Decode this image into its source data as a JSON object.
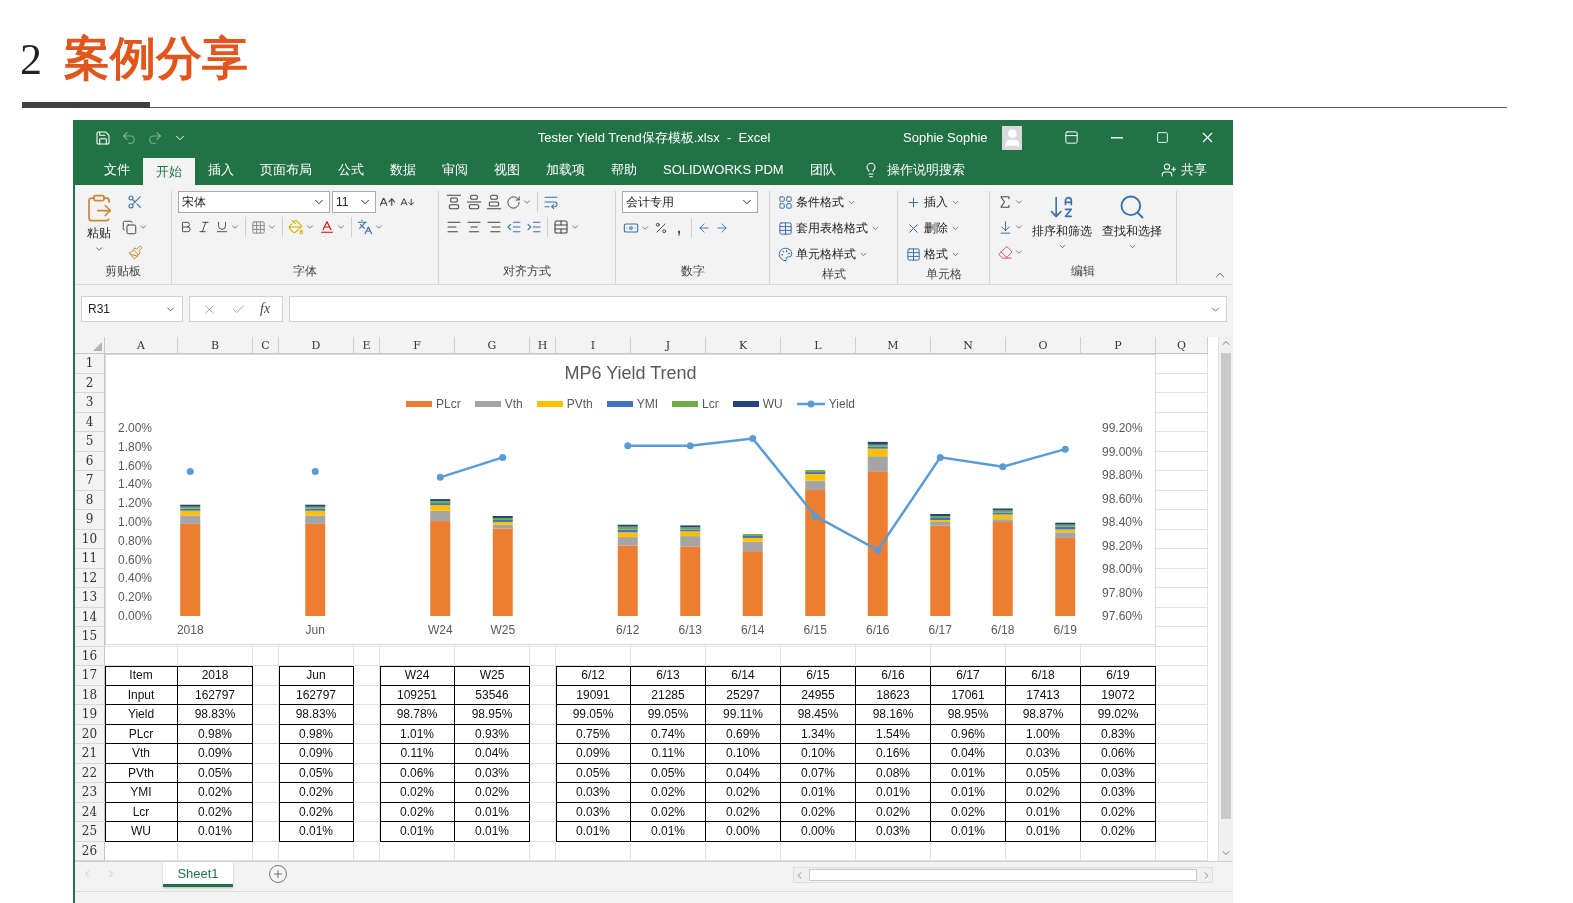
{
  "slide": {
    "number": "2",
    "title": "案例分享"
  },
  "excel": {
    "title_bar": {
      "file": "Tester Yield Trend保存模板.xlsx  -  Excel",
      "user": "Sophie Sophie"
    },
    "tabs": [
      {
        "label": "文件",
        "selected": false
      },
      {
        "label": "开始",
        "selected": true
      },
      {
        "label": "插入",
        "selected": false
      },
      {
        "label": "页面布局",
        "selected": false
      },
      {
        "label": "公式",
        "selected": false
      },
      {
        "label": "数据",
        "selected": false
      },
      {
        "label": "审阅",
        "selected": false
      },
      {
        "label": "视图",
        "selected": false
      },
      {
        "label": "加载项",
        "selected": false
      },
      {
        "label": "帮助",
        "selected": false
      },
      {
        "label": "SOLIDWORKS PDM",
        "selected": false
      },
      {
        "label": "团队",
        "selected": false
      }
    ],
    "tell_me": "操作说明搜索",
    "share": "共享",
    "ribbon": {
      "clipboard": {
        "label": "剪贴板",
        "paste": "粘贴"
      },
      "font": {
        "label": "字体",
        "name": "宋体",
        "size": "11"
      },
      "alignment": {
        "label": "对齐方式"
      },
      "number": {
        "label": "数字",
        "format": "会计专用",
        "comma": ","
      },
      "styles": {
        "label": "样式",
        "items": [
          "条件格式",
          "套用表格格式",
          "单元格样式"
        ]
      },
      "cells": {
        "label": "单元格",
        "items": [
          "插入",
          "删除",
          "格式"
        ]
      },
      "editing": {
        "label": "编辑",
        "sort": "排序和筛选",
        "find": "查找和选择"
      }
    },
    "formula_bar": {
      "name_box": "R31",
      "fx": "fx"
    },
    "column_headers": [
      "A",
      "B",
      "C",
      "D",
      "E",
      "F",
      "G",
      "H",
      "I",
      "J",
      "K",
      "L",
      "M",
      "N",
      "O",
      "P",
      "Q"
    ],
    "row_numbers": [
      "1",
      "2",
      "3",
      "4",
      "5",
      "6",
      "7",
      "8",
      "9",
      "10",
      "11",
      "12",
      "13",
      "14",
      "15",
      "16",
      "17",
      "18",
      "19",
      "20",
      "21",
      "22",
      "23",
      "24",
      "25",
      "26"
    ],
    "chart": {
      "chart_data": {
        "type": "bar",
        "title": "MP6 Yield Trend",
        "stacked": true,
        "legend": "top",
        "categories": [
          "2018",
          null,
          "Jun",
          null,
          "W24",
          "W25",
          null,
          "6/12",
          "6/13",
          "6/14",
          "6/15",
          "6/16",
          "6/17",
          "6/18",
          "6/19"
        ],
        "ylim": [
          0,
          2
        ],
        "yticks": [
          {
            "value": 0,
            "label": "0.00%"
          },
          {
            "value": 0.2,
            "label": "0.20%"
          },
          {
            "value": 0.4,
            "label": "0.40%"
          },
          {
            "value": 0.6,
            "label": "0.60%"
          },
          {
            "value": 0.8,
            "label": "0.80%"
          },
          {
            "value": 1,
            "label": "1.00%"
          },
          {
            "value": 1.2,
            "label": "1.20%"
          },
          {
            "value": 1.4,
            "label": "1.40%"
          },
          {
            "value": 1.6,
            "label": "1.60%"
          },
          {
            "value": 1.8,
            "label": "1.80%"
          },
          {
            "value": 2,
            "label": "2.00%"
          }
        ],
        "y2lim": [
          97.6,
          99.2
        ],
        "y2ticks": [
          {
            "value": 97.6,
            "label": "97.60%"
          },
          {
            "value": 97.8,
            "label": "97.80%"
          },
          {
            "value": 98,
            "label": "98.00%"
          },
          {
            "value": 98.2,
            "label": "98.20%"
          },
          {
            "value": 98.4,
            "label": "98.40%"
          },
          {
            "value": 98.6,
            "label": "98.60%"
          },
          {
            "value": 98.8,
            "label": "98.80%"
          },
          {
            "value": 99,
            "label": "99.00%"
          },
          {
            "value": 99.2,
            "label": "99.20%"
          }
        ],
        "series": [
          {
            "name": "PLcr",
            "color": "#ed7d31",
            "values": [
              0.98,
              null,
              0.98,
              null,
              1.01,
              0.93,
              null,
              0.75,
              0.74,
              0.69,
              1.34,
              1.54,
              0.96,
              1.0,
              0.83
            ]
          },
          {
            "name": "Vth",
            "color": "#a5a5a5",
            "values": [
              0.09,
              null,
              0.09,
              null,
              0.11,
              0.04,
              null,
              0.09,
              0.11,
              0.1,
              0.1,
              0.16,
              0.04,
              0.03,
              0.06
            ]
          },
          {
            "name": "PVth",
            "color": "#ffc000",
            "values": [
              0.05,
              null,
              0.05,
              null,
              0.06,
              0.03,
              null,
              0.05,
              0.05,
              0.04,
              0.07,
              0.08,
              0.01,
              0.05,
              0.03
            ]
          },
          {
            "name": "YMI",
            "color": "#4472c4",
            "values": [
              0.02,
              null,
              0.02,
              null,
              0.02,
              0.02,
              null,
              0.03,
              0.02,
              0.02,
              0.01,
              0.01,
              0.01,
              0.02,
              0.03
            ]
          },
          {
            "name": "Lcr",
            "color": "#70ad47",
            "values": [
              0.02,
              null,
              0.02,
              null,
              0.02,
              0.01,
              null,
              0.03,
              0.02,
              0.02,
              0.02,
              0.02,
              0.02,
              0.01,
              0.02
            ]
          },
          {
            "name": "WU",
            "color": "#264478",
            "values": [
              0.01,
              null,
              0.01,
              null,
              0.01,
              0.01,
              null,
              0.01,
              0.01,
              0.0,
              0.0,
              0.03,
              0.01,
              0.01,
              0.02
            ]
          },
          {
            "name": "Yield",
            "color": "#5b9bd5",
            "type": "line",
            "axis": "y2",
            "marker": "circle",
            "values": [
              98.83,
              null,
              98.83,
              null,
              98.78,
              98.95,
              null,
              99.05,
              99.05,
              99.11,
              98.45,
              98.16,
              98.95,
              98.87,
              99.02
            ]
          }
        ]
      }
    },
    "table": {
      "columns": [
        "Item",
        "2018",
        "Jun",
        "W24",
        "W25",
        "6/12",
        "6/13",
        "6/14",
        "6/15",
        "6/16",
        "6/17",
        "6/18",
        "6/19"
      ],
      "rows": [
        [
          "Input",
          "162797",
          "162797",
          "109251",
          "53546",
          "19091",
          "21285",
          "25297",
          "24955",
          "18623",
          "17061",
          "17413",
          "19072"
        ],
        [
          "Yield",
          "98.83%",
          "98.83%",
          "98.78%",
          "98.95%",
          "99.05%",
          "99.05%",
          "99.11%",
          "98.45%",
          "98.16%",
          "98.95%",
          "98.87%",
          "99.02%"
        ],
        [
          "PLcr",
          "0.98%",
          "0.98%",
          "1.01%",
          "0.93%",
          "0.75%",
          "0.74%",
          "0.69%",
          "1.34%",
          "1.54%",
          "0.96%",
          "1.00%",
          "0.83%"
        ],
        [
          "Vth",
          "0.09%",
          "0.09%",
          "0.11%",
          "0.04%",
          "0.09%",
          "0.11%",
          "0.10%",
          "0.10%",
          "0.16%",
          "0.04%",
          "0.03%",
          "0.06%"
        ],
        [
          "PVth",
          "0.05%",
          "0.05%",
          "0.06%",
          "0.03%",
          "0.05%",
          "0.05%",
          "0.04%",
          "0.07%",
          "0.08%",
          "0.01%",
          "0.05%",
          "0.03%"
        ],
        [
          "YMI",
          "0.02%",
          "0.02%",
          "0.02%",
          "0.02%",
          "0.03%",
          "0.02%",
          "0.02%",
          "0.01%",
          "0.01%",
          "0.01%",
          "0.02%",
          "0.03%"
        ],
        [
          "Lcr",
          "0.02%",
          "0.02%",
          "0.02%",
          "0.01%",
          "0.03%",
          "0.02%",
          "0.02%",
          "0.02%",
          "0.02%",
          "0.02%",
          "0.01%",
          "0.02%"
        ],
        [
          "WU",
          "0.01%",
          "0.01%",
          "0.01%",
          "0.01%",
          "0.01%",
          "0.01%",
          "0.00%",
          "0.00%",
          "0.03%",
          "0.01%",
          "0.01%",
          "0.02%"
        ]
      ]
    },
    "sheet_tabs": [
      {
        "label": "Sheet1",
        "selected": true
      }
    ]
  }
}
